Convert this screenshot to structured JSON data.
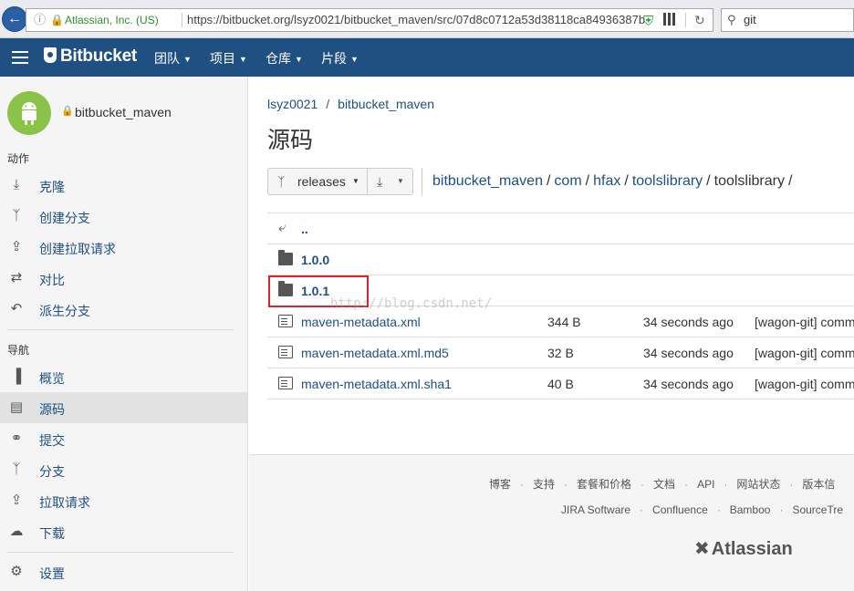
{
  "browser": {
    "site_identity": "Atlassian, Inc. (US)",
    "url": "https://bitbucket.org/lsyz0021/bitbucket_maven/src/07d8c0712a53d38118ca84936387b",
    "search_value": "git"
  },
  "topnav": {
    "brand": "Bitbucket",
    "items": [
      {
        "label": "团队"
      },
      {
        "label": "项目"
      },
      {
        "label": "仓库"
      },
      {
        "label": "片段"
      }
    ]
  },
  "sidebar": {
    "repo_name": "bitbucket_maven",
    "actions_heading": "动作",
    "actions": [
      {
        "label": "克隆",
        "icon": "clone-icon"
      },
      {
        "label": "创建分支",
        "icon": "create-branch-icon"
      },
      {
        "label": "创建拉取请求",
        "icon": "create-pull-request-icon"
      },
      {
        "label": "对比",
        "icon": "compare-icon"
      },
      {
        "label": "派生分支",
        "icon": "fork-icon"
      }
    ],
    "nav_heading": "导航",
    "nav": [
      {
        "label": "概览",
        "icon": "overview-icon"
      },
      {
        "label": "源码",
        "icon": "source-icon",
        "active": true
      },
      {
        "label": "提交",
        "icon": "commits-icon"
      },
      {
        "label": "分支",
        "icon": "branches-icon"
      },
      {
        "label": "拉取请求",
        "icon": "pull-requests-icon"
      },
      {
        "label": "下载",
        "icon": "downloads-icon"
      }
    ],
    "settings": {
      "label": "设置",
      "icon": "settings-icon"
    }
  },
  "main": {
    "breadcrumb": {
      "owner": "lsyz0021",
      "repo": "bitbucket_maven"
    },
    "title": "源码",
    "branch_label": "releases",
    "path": {
      "parts": [
        "bitbucket_maven",
        "com",
        "hfax",
        "toolslibrary"
      ],
      "current": "toolslibrary"
    },
    "parent_label": "..",
    "rows": [
      {
        "type": "folder",
        "name": "1.0.0"
      },
      {
        "type": "folder",
        "name": "1.0.1"
      },
      {
        "type": "file",
        "name": "maven-metadata.xml",
        "size": "344 B",
        "time": "34 seconds ago",
        "message": "[wagon-git] comm"
      },
      {
        "type": "file",
        "name": "maven-metadata.xml.md5",
        "size": "32 B",
        "time": "34 seconds ago",
        "message": "[wagon-git] comm"
      },
      {
        "type": "file",
        "name": "maven-metadata.xml.sha1",
        "size": "40 B",
        "time": "34 seconds ago",
        "message": "[wagon-git] comm"
      }
    ],
    "watermark": "http://blog.csdn.net/"
  },
  "footer": {
    "links1": [
      "博客",
      "支持",
      "套餐和价格",
      "文档",
      "API",
      "网站状态",
      "版本信"
    ],
    "links2": [
      "JIRA Software",
      "Confluence",
      "Bamboo",
      "SourceTre"
    ],
    "logo": "Atlassian"
  },
  "colors": {
    "nav_bg": "#205081",
    "link": "#205081",
    "highlight": "#d9232d",
    "avatar": "#8bc34a"
  }
}
